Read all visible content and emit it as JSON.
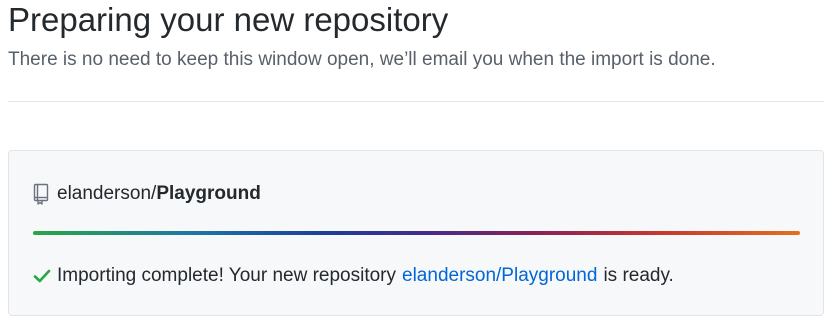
{
  "header": {
    "title": "Preparing your new repository",
    "subtitle": "There is no need to keep this window open, we’ll email you when the import is done."
  },
  "repo": {
    "owner": "elanderson",
    "separator": "/",
    "name": "Playground",
    "icon": "repo-icon"
  },
  "progress": {
    "fraction": 1.0
  },
  "status": {
    "icon": "check-icon",
    "prefix": "Importing complete! Your new repository",
    "link_text": "elanderson/Playground",
    "suffix": "is ready."
  },
  "colors": {
    "text": "#24292e",
    "muted": "#586069",
    "link": "#0366d6",
    "success": "#28a745",
    "box_bg": "#f6f8fa",
    "border": "#e1e4e8"
  }
}
